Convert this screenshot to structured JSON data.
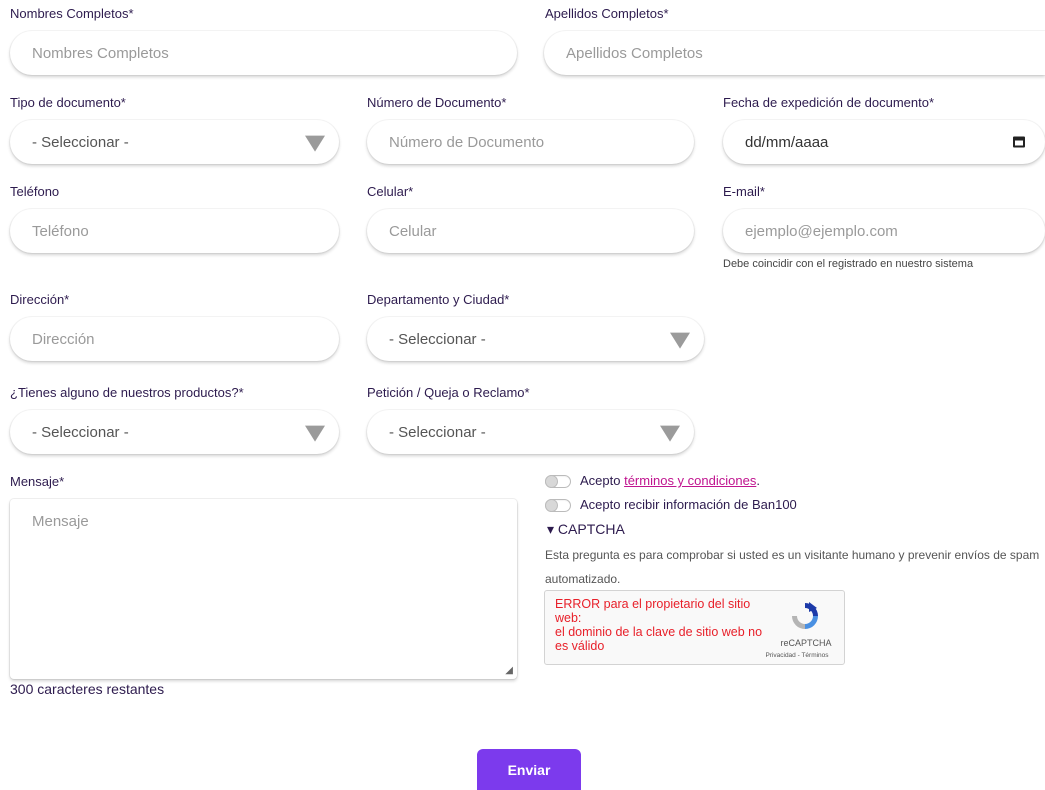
{
  "form": {
    "nombres": {
      "label": "Nombres Completos*",
      "placeholder": "Nombres Completos"
    },
    "apellidos": {
      "label": "Apellidos Completos*",
      "placeholder": "Apellidos Completos"
    },
    "tipo_documento": {
      "label": "Tipo de documento*",
      "value": "- Seleccionar -"
    },
    "numero_documento": {
      "label": "Número de Documento*",
      "placeholder": "Número de Documento"
    },
    "fecha_expedicion": {
      "label": "Fecha de expedición de documento*",
      "placeholder": "dd/mm/aaaa",
      "icon": "calendar-icon"
    },
    "telefono": {
      "label": "Teléfono",
      "placeholder": "Teléfono"
    },
    "celular": {
      "label": "Celular*",
      "placeholder": "Celular"
    },
    "email": {
      "label": "E-mail*",
      "placeholder": "ejemplo@ejemplo.com",
      "hint": "Debe coincidir con el registrado en nuestro sistema"
    },
    "direccion": {
      "label": "Dirección*",
      "placeholder": "Dirección"
    },
    "departamento_ciudad": {
      "label": "Departamento y Ciudad*",
      "value": "- Seleccionar -"
    },
    "productos": {
      "label": "¿Tienes alguno de nuestros productos?*",
      "value": "- Seleccionar -"
    },
    "peticion": {
      "label": "Petición / Queja o Reclamo*",
      "value": "- Seleccionar -"
    },
    "mensaje": {
      "label": "Mensaje*",
      "placeholder": "Mensaje",
      "counter": "300 caracteres restantes"
    }
  },
  "consents": {
    "terms_prefix": "Acepto ",
    "terms_link": "términos y condiciones",
    "terms_suffix": ".",
    "info": "Acepto recibir información de Ban100"
  },
  "captcha": {
    "title": "▾ CAPTCHA",
    "description": "Esta pregunta es para comprobar si usted es un visitante humano y prevenir envíos de spam automatizado.",
    "error_line1": "ERROR para el propietario del sitio web:",
    "error_line2": "el dominio de la clave de sitio web no es válido",
    "brand": "reCAPTCHA",
    "links": "Privacidad - Términos"
  },
  "submit_label": "Enviar",
  "colors": {
    "accent": "#7c3aed",
    "link": "#c0148f",
    "error": "#e8202a",
    "text": "#2d1b4e"
  }
}
